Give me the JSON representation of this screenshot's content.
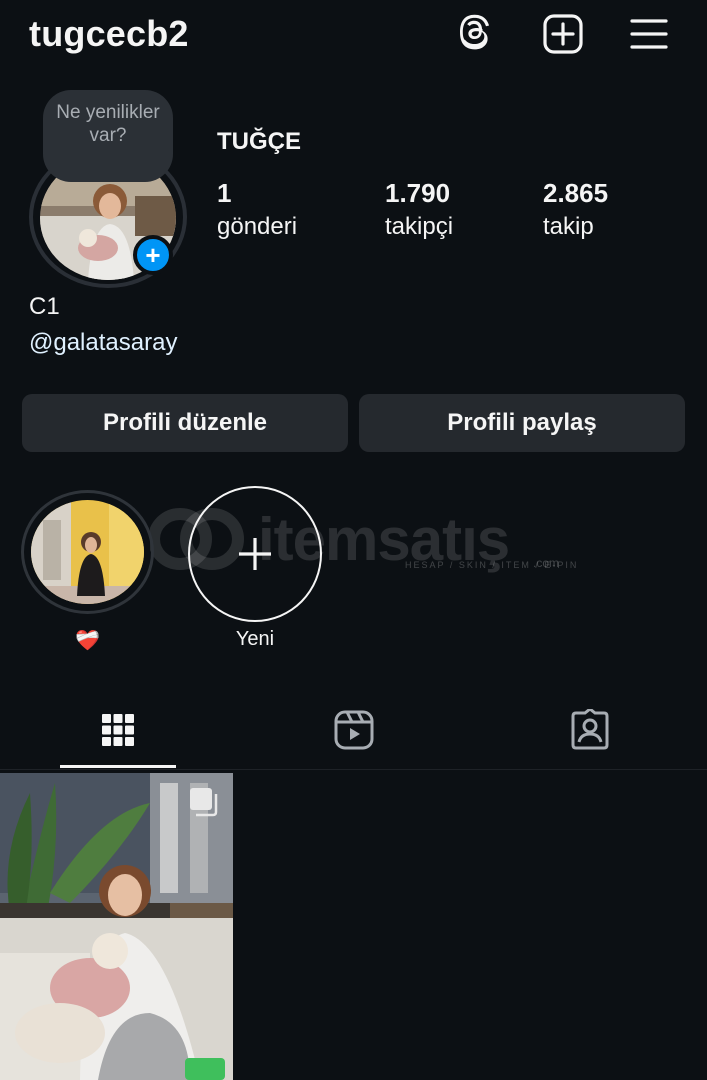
{
  "header": {
    "username": "tugcecb2",
    "icons": [
      "threads-icon",
      "create-post-icon",
      "menu-icon"
    ]
  },
  "profile": {
    "note_text": "Ne yenilikler var?",
    "display_name": "TUĞÇE",
    "stats": [
      {
        "value": "1",
        "label": "gönderi"
      },
      {
        "value": "1.790",
        "label": "takipçi"
      },
      {
        "value": "2.865",
        "label": "takip"
      }
    ],
    "bio": "C1",
    "mention": "@galatasaray"
  },
  "buttons": {
    "edit": "Profili düzenle",
    "share": "Profili paylaş"
  },
  "highlights": [
    {
      "label": "❤️‍🩹"
    },
    {
      "label": "Yeni"
    }
  ],
  "watermark": {
    "brand": "itemsatış",
    "tagline": "HESAP / SKIN / ITEM / E-PIN",
    "suffix": ".com"
  },
  "tabs": [
    "grid-icon",
    "reels-icon",
    "tagged-icon"
  ],
  "colors": {
    "background": "#0c1014",
    "button_bg": "#25292e",
    "accent_blue": "#0095f6"
  }
}
